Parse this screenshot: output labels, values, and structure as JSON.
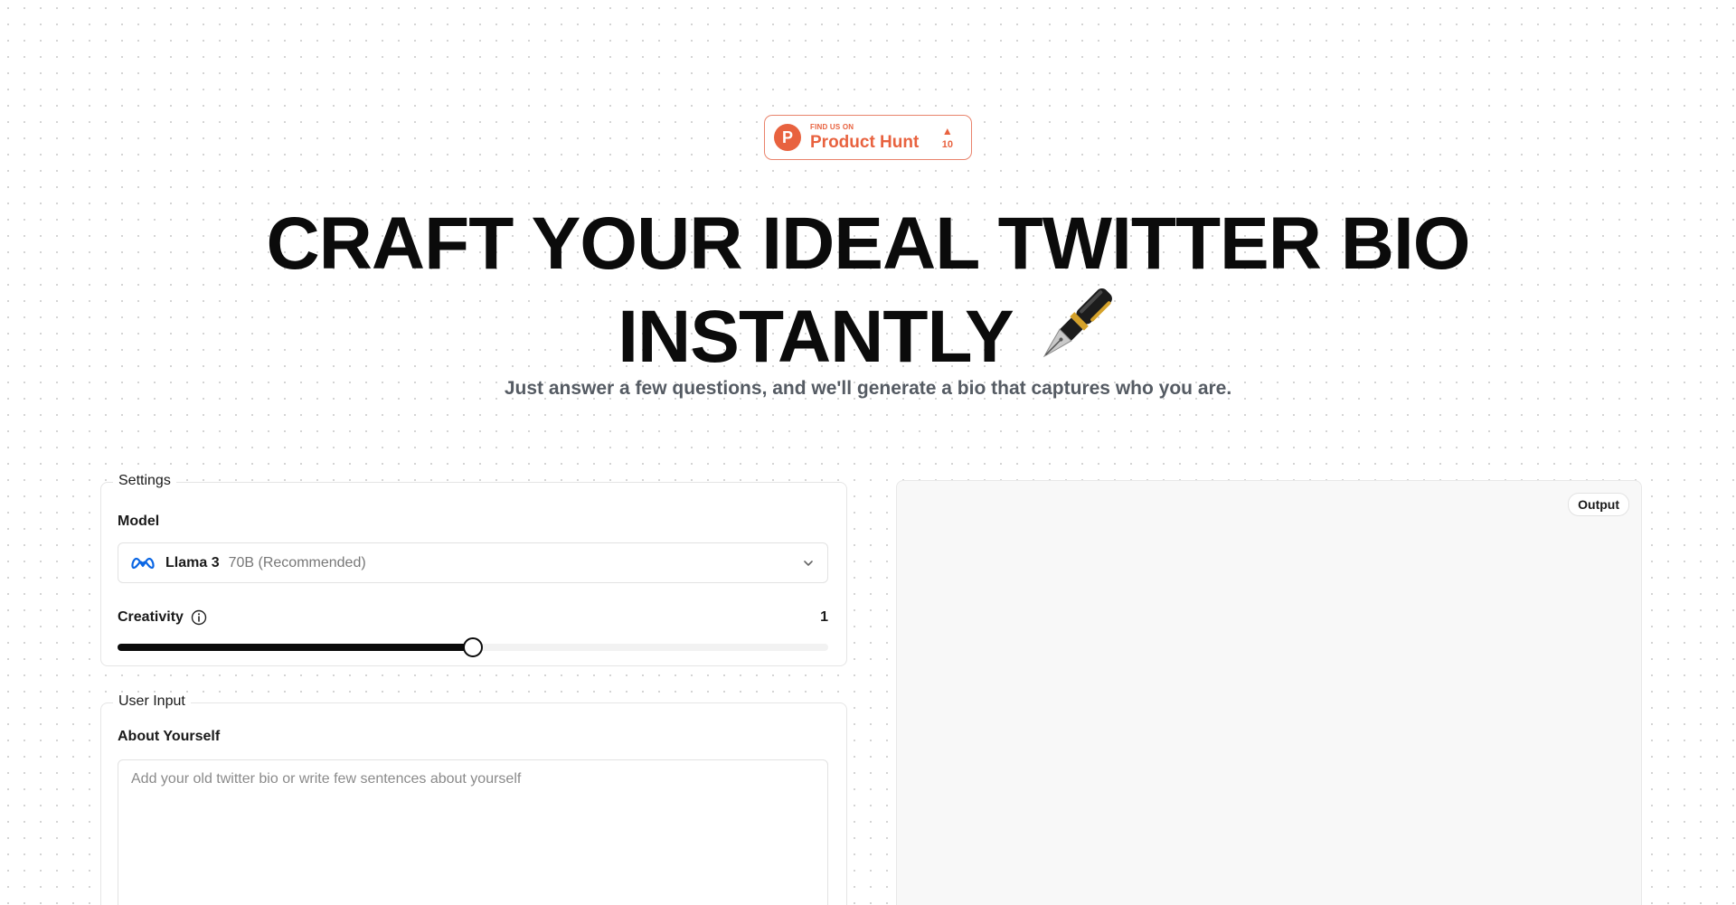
{
  "badge": {
    "small": "FIND US ON",
    "big": "Product Hunt",
    "logo_letter": "P",
    "arrow": "▲",
    "votes": "10",
    "color": "#e8623f"
  },
  "hero": {
    "title_line1": "CRAFT YOUR IDEAL TWITTER BIO",
    "title_line2": "INSTANTLY",
    "title_icon": "fountain-pen-icon",
    "subtitle": "Just answer a few questions, and we'll generate a bio that captures who you are."
  },
  "settings": {
    "legend": "Settings",
    "model_label": "Model",
    "model_icon": "meta-icon",
    "model_name": "Llama 3",
    "model_variant": "70B (Recommended)",
    "creativity_label": "Creativity",
    "creativity_value": "1",
    "creativity_fraction": 0.5
  },
  "user_input": {
    "legend": "User Input",
    "about_label": "About Yourself",
    "about_placeholder": "Add your old twitter bio or write few sentences about yourself",
    "about_value": ""
  },
  "output": {
    "badge": "Output"
  }
}
